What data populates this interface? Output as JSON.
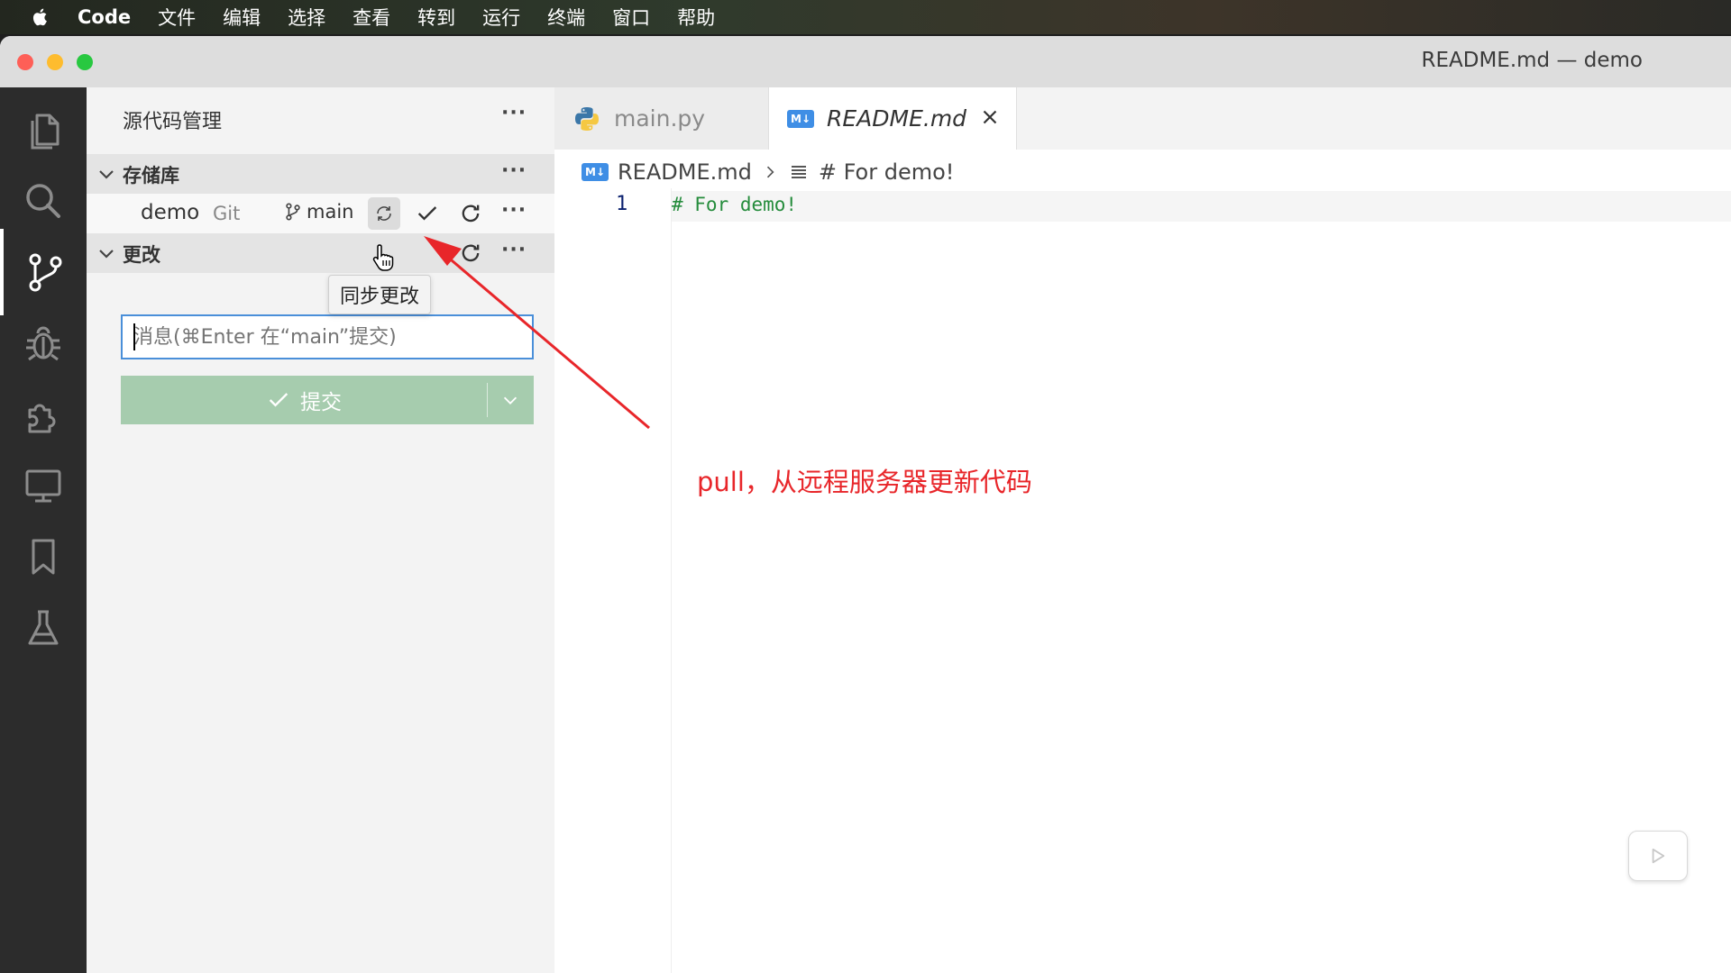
{
  "menubar": {
    "app": "Code",
    "items": [
      "文件",
      "编辑",
      "选择",
      "查看",
      "转到",
      "运行",
      "终端",
      "窗口",
      "帮助"
    ]
  },
  "window": {
    "title": "README.md — demo"
  },
  "activity_bar": {
    "icons": [
      "files-icon",
      "search-icon",
      "source-control-icon",
      "debug-icon",
      "extensions-icon",
      "remote-explorer-icon",
      "bookmark-icon",
      "testing-icon"
    ],
    "active": "source-control-icon"
  },
  "sidebar": {
    "title": "源代码管理",
    "more": "···",
    "repositories": {
      "label": "存储库",
      "repo_name": "demo",
      "repo_type": "Git",
      "branch": "main"
    },
    "changes": {
      "label": "更改",
      "message_placeholder": "消息(⌘Enter 在“main”提交)",
      "commit_label": "提交"
    },
    "tooltip": "同步更改"
  },
  "editor": {
    "tabs": [
      {
        "label": "main.py",
        "active": false
      },
      {
        "label": "README.md",
        "active": true
      }
    ],
    "breadcrumb": {
      "file": "README.md",
      "symbol": "# For demo!"
    },
    "lines": [
      {
        "number": "1",
        "text": "# For demo!"
      }
    ]
  },
  "annotation": {
    "text": "pull，从远程服务器更新代码",
    "color": "#e8262a"
  },
  "colors": {
    "activity_bar": "#2c2c2c",
    "sidebar": "#f3f3f3",
    "commit_button": "#a6ccae",
    "input_focus": "#4a8fd9",
    "markdown_heading": "#258c3c"
  }
}
